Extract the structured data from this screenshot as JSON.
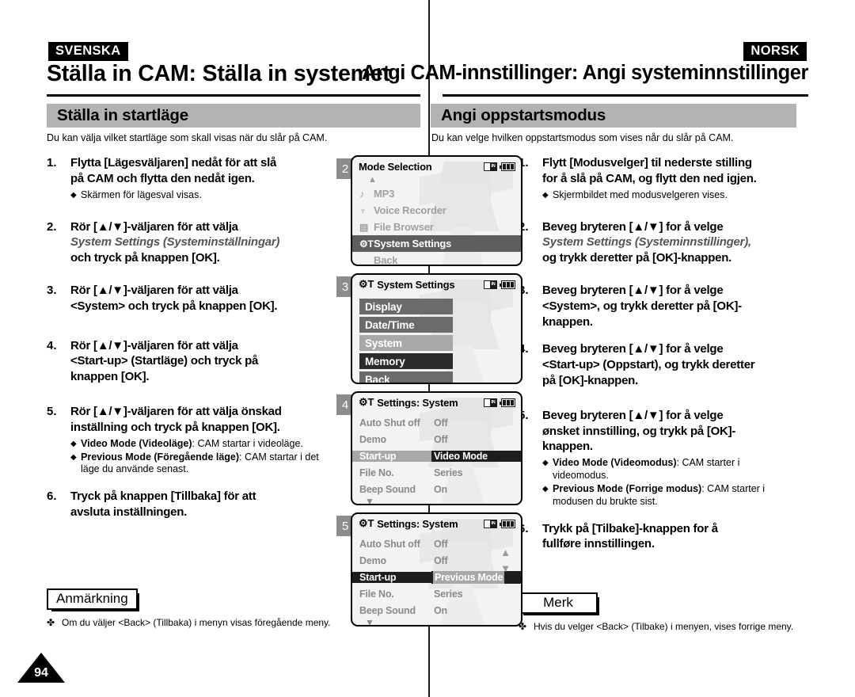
{
  "page_number": "94",
  "columns": {
    "swedish": {
      "language_tag": "SVENSKA",
      "chapter_title": "Ställa in CAM: Ställa in systemet",
      "section_title": "Ställa in startläge",
      "section_intro": "Du kan välja vilket startläge som skall visas när du slår på CAM.",
      "steps": [
        {
          "number": "1.",
          "line1": "Flytta [Lägesväljaren] nedåt för att slå",
          "line2": "på CAM och flytta den nedåt igen.",
          "sub": [
            {
              "bullet": "◆",
              "text": "Skärmen för lägesval visas."
            }
          ]
        },
        {
          "number": "2.",
          "line1": "Rör [▲/▼]-väljaren för att välja",
          "italic": "System Settings (Systeminställningar)",
          "line3": "och tryck på knappen [OK]."
        },
        {
          "number": "3.",
          "line1": "Rör [▲/▼]-väljaren för att välja",
          "line2": "<System> och tryck på knappen [OK]."
        },
        {
          "number": "4.",
          "line1": "Rör [▲/▼]-väljaren för att välja",
          "line2": "<Start-up> (Startläge) och tryck på",
          "line3": "knappen [OK]."
        },
        {
          "number": "5.",
          "line1": "Rör [▲/▼]-väljaren för att välja önskad",
          "line2": "inställning och tryck på knappen [OK].",
          "sub": [
            {
              "bullet": "◆",
              "bold": "Video Mode (Videoläge)",
              "text": ": CAM startar i videoläge."
            },
            {
              "bullet": "◆",
              "bold": "Previous Mode (Föregående läge)",
              "text": ": CAM startar i det läge du använde senast."
            }
          ]
        },
        {
          "number": "6.",
          "line1": "Tryck på knappen [Tillbaka] för att",
          "line2": "avsluta inställningen."
        }
      ],
      "note": {
        "label": "Anmärkning",
        "mark": "✤",
        "text": "Om du väljer <Back> (Tillbaka) i menyn visas föregående meny."
      }
    },
    "norwegian": {
      "language_tag": "NORSK",
      "chapter_title": "Angi CAM-innstillinger: Angi systeminnstillinger",
      "section_title": "Angi oppstartsmodus",
      "section_intro": "Du kan velge hvilken oppstartsmodus som vises når du slår på CAM.",
      "steps": [
        {
          "number": "1.",
          "line1": "Flytt [Modusvelger] til nederste stilling",
          "line2": "for å slå på CAM, og flytt den ned igjen.",
          "sub": [
            {
              "bullet": "◆",
              "text": "Skjermbildet med modusvelgeren vises."
            }
          ]
        },
        {
          "number": "2.",
          "line1": "Beveg bryteren [▲/▼] for å velge",
          "italic": "System Settings (Systeminnstillinger),",
          "line3": "og trykk deretter på [OK]-knappen."
        },
        {
          "number": "3.",
          "line1": "Beveg bryteren [▲/▼] for å velge",
          "line2": "<System>, og trykk deretter på [OK]-",
          "line3": "knappen."
        },
        {
          "number": "4.",
          "line1": "Beveg bryteren [▲/▼] for å velge",
          "line2": "<Start-up> (Oppstart), og trykk deretter",
          "line3": "på [OK]-knappen."
        },
        {
          "number": "5.",
          "line1": "Beveg bryteren [▲/▼] for å velge",
          "line2": "ønsket innstilling, og trykk på [OK]-",
          "line3": "knappen.",
          "sub": [
            {
              "bullet": "◆",
              "bold": "Video Mode (Videomodus)",
              "text": ": CAM starter i videomodus."
            },
            {
              "bullet": "◆",
              "bold": "Previous Mode (Forrige modus)",
              "text": ": CAM starter i modusen du brukte sist."
            }
          ]
        },
        {
          "number": "6.",
          "line1": "Trykk på [Tilbake]-knappen for å",
          "line2": "fullføre innstillingen."
        }
      ],
      "note": {
        "label": "Merk",
        "mark": "✤",
        "text": "Hvis du velger <Back> (Tilbake) i menyen, vises forrige meny."
      }
    }
  },
  "lcd_screens": [
    {
      "step_badge": "2",
      "title": "Mode Selection",
      "title_icon": "",
      "status_icons": [
        "memory-card-icon",
        "battery-icon"
      ],
      "type": "mode-list",
      "scroll_up": "▲",
      "items": [
        {
          "icon": "♪",
          "label": "MP3",
          "state": "normal"
        },
        {
          "icon": "♆",
          "label": "Voice Recorder",
          "state": "normal"
        },
        {
          "icon": "▤",
          "label": "File Browser",
          "state": "normal"
        },
        {
          "icon": "⚙T",
          "label": "System Settings",
          "state": "selected"
        },
        {
          "icon": "",
          "label": "Back",
          "state": "normal"
        }
      ]
    },
    {
      "step_badge": "3",
      "title": "System Settings",
      "title_icon": "⚙T",
      "status_icons": [
        "memory-card-icon",
        "battery-icon"
      ],
      "type": "block-list",
      "items": [
        {
          "label": "Display",
          "state": "normal"
        },
        {
          "label": "Date/Time",
          "state": "normal"
        },
        {
          "label": "System",
          "state": "highlight"
        },
        {
          "label": "Memory",
          "state": "dark"
        },
        {
          "label": "Back",
          "state": "normal"
        }
      ]
    },
    {
      "step_badge": "4",
      "title": "Settings: System",
      "title_icon": "⚙T",
      "status_icons": [
        "memory-card-icon",
        "battery-icon"
      ],
      "type": "settings-table",
      "scroll_down": "▼",
      "side_arrows": false,
      "rows": [
        {
          "label": "Auto Shut off",
          "value": "Off",
          "state": "normal"
        },
        {
          "label": "Demo",
          "value": "Off",
          "state": "normal"
        },
        {
          "label": "Start-up",
          "value": "Video Mode",
          "state": "active"
        },
        {
          "label": "File No.",
          "value": "Series",
          "state": "normal"
        },
        {
          "label": "Beep Sound",
          "value": "On",
          "state": "normal"
        }
      ]
    },
    {
      "step_badge": "5",
      "title": "Settings: System",
      "title_icon": "⚙T",
      "status_icons": [
        "memory-card-icon",
        "battery-icon"
      ],
      "type": "settings-table",
      "scroll_down": "▼",
      "side_arrows": true,
      "rows": [
        {
          "label": "Auto Shut off",
          "value": "Off",
          "state": "normal"
        },
        {
          "label": "Demo",
          "value": "Off",
          "state": "normal"
        },
        {
          "label": "Start-up",
          "value": "Previous Mode",
          "state": "active-dark"
        },
        {
          "label": "File No.",
          "value": "Series",
          "state": "normal"
        },
        {
          "label": "Beep Sound",
          "value": "On",
          "state": "normal"
        }
      ]
    }
  ],
  "colors": {
    "banner_gray": "#b3b3b3",
    "badge_gray": "#8c8c8c",
    "lcd_bg": "#f3f3f3",
    "lcd_selected": "#5e5e5e",
    "lcd_dark": "#1d1d1d",
    "lcd_highlight": "#a8a8a8"
  }
}
